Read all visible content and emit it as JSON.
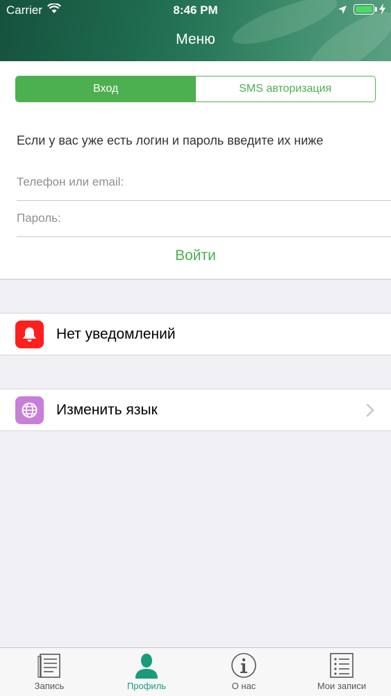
{
  "status_bar": {
    "carrier": "Carrier",
    "time": "8:46 PM"
  },
  "header": {
    "title": "Меню"
  },
  "login": {
    "tabs": [
      {
        "label": "Вход",
        "selected": true
      },
      {
        "label": "SMS авторизация",
        "selected": false
      }
    ],
    "hint": "Если у вас уже есть логин и пароль введите их ниже",
    "phone_placeholder": "Телефон или email:",
    "password_placeholder": "Пароль:",
    "submit_label": "Войти"
  },
  "settings": {
    "notifications": {
      "label": "Нет уведомлений",
      "icon": "bell-icon",
      "color": "#ff1f1f"
    },
    "language": {
      "label": "Изменить язык",
      "icon": "globe-icon",
      "color": "#c77fd9"
    }
  },
  "tabbar": {
    "items": [
      {
        "label": "Запись",
        "icon": "document-icon"
      },
      {
        "label": "Профиль",
        "icon": "person-icon",
        "active": true
      },
      {
        "label": "О нас",
        "icon": "info-icon"
      },
      {
        "label": "Мои записи",
        "icon": "list-icon"
      }
    ]
  },
  "colors": {
    "accent": "#4caf50",
    "tab_active": "#1a9c7c",
    "header": "#1e6a4f"
  }
}
